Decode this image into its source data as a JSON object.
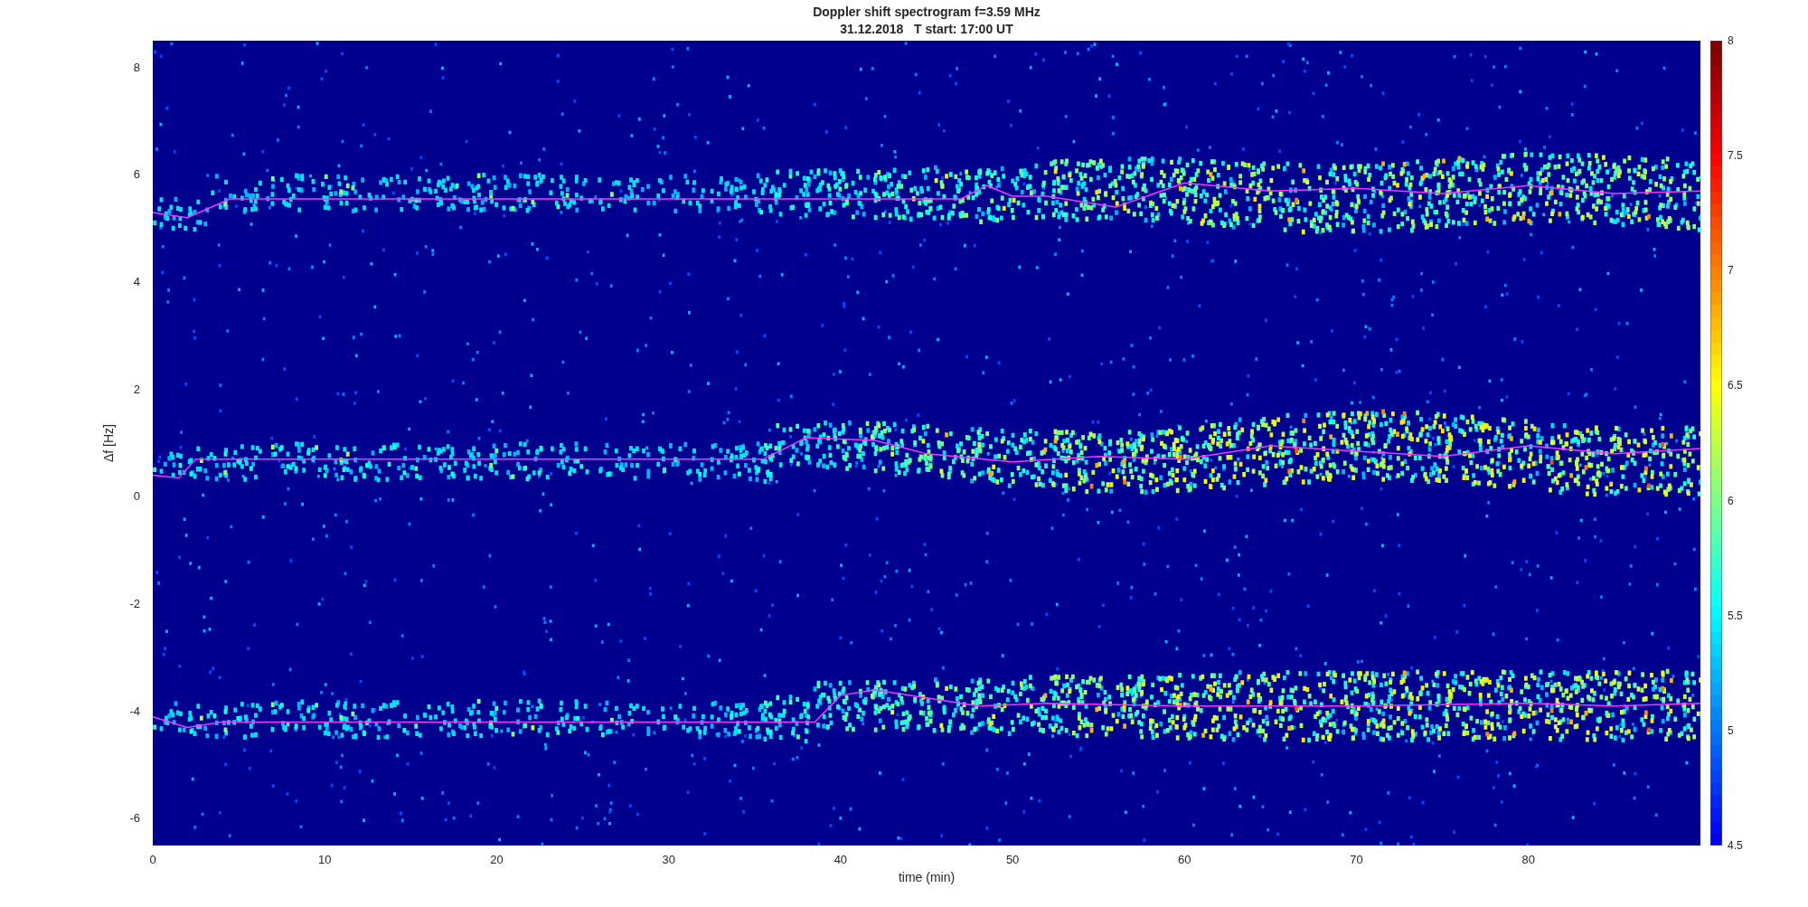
{
  "figure": {
    "title": [
      "Doppler shift spectrogram f=3.59 MHz",
      "31.12.2018   T start: 17:00 UT"
    ]
  },
  "y_axis": {
    "label": "Δf [Hz]",
    "ticks": [
      "8",
      "6",
      "4",
      "2",
      "0",
      "-2",
      "-4",
      "-6"
    ]
  },
  "x_axis": {
    "label": "time (min)",
    "ticks": [
      "0",
      "10",
      "20",
      "30",
      "40",
      "50",
      "60",
      "70",
      "80"
    ]
  },
  "colorbar": {
    "ticks": [
      "8",
      "7.5",
      "7",
      "6.5",
      "6",
      "5.5",
      "5",
      "4.5"
    ]
  }
}
